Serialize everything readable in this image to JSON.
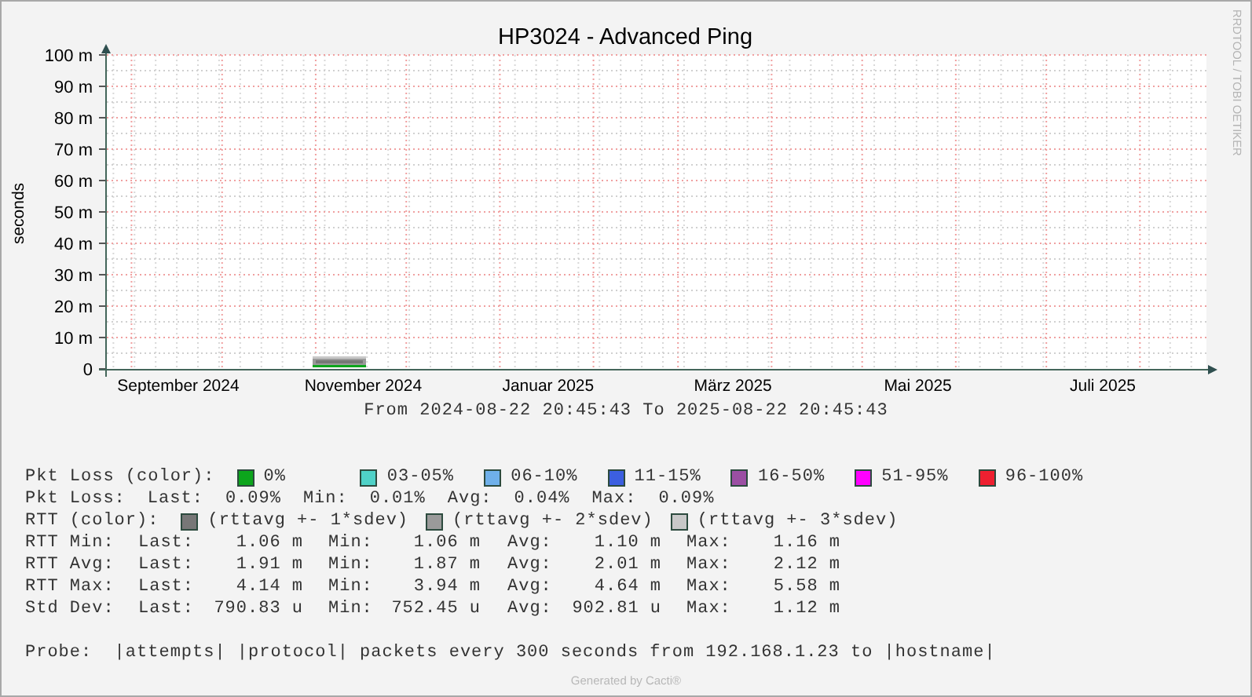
{
  "chart": {
    "title": "HP3024 - Advanced Ping",
    "watermark": "RRDTOOL / TOBI OETIKER",
    "ylabel": "seconds",
    "yticks": [
      "100 m",
      "90 m",
      "80 m",
      "70 m",
      "60 m",
      "50 m",
      "40 m",
      "30 m",
      "20 m",
      "10 m",
      "0"
    ],
    "xticks": [
      "September 2024",
      "November 2024",
      "Januar 2025",
      "März 2025",
      "Mai 2025",
      "Juli 2025"
    ],
    "period": "From 2024-08-22 20:45:43 To 2025-08-22 20:45:43"
  },
  "legend": [
    {
      "kind": "swatches",
      "label": "Pkt Loss (color):",
      "items": [
        {
          "label": "0%",
          "color": "#0ca51c"
        },
        {
          "label": "03-05%",
          "color": "#4fd2c8"
        },
        {
          "label": "06-10%",
          "color": "#6fb0ea"
        },
        {
          "label": "11-15%",
          "color": "#3c5fe0"
        },
        {
          "label": "16-50%",
          "color": "#9b4fa3"
        },
        {
          "label": "51-95%",
          "color": "#ff00ff"
        },
        {
          "label": "96-100%",
          "color": "#ee2030"
        }
      ]
    },
    {
      "kind": "inline",
      "label": "Pkt Loss:",
      "cells": [
        {
          "name": "Last:",
          "value": "0.09%"
        },
        {
          "name": "Min:",
          "value": "0.01%"
        },
        {
          "name": "Avg:",
          "value": "0.04%"
        },
        {
          "name": "Max:",
          "value": "0.09%"
        }
      ]
    },
    {
      "kind": "swatches",
      "label": "RTT (color):",
      "items": [
        {
          "label": "(rttavg +- 1*sdev)",
          "color": "#777777"
        },
        {
          "label": "(rttavg +- 2*sdev)",
          "color": "#9a9a9a"
        },
        {
          "label": "(rttavg +- 3*sdev)",
          "color": "#c8c8c8"
        }
      ]
    },
    {
      "kind": "table",
      "label": "RTT Min:",
      "cells": [
        {
          "name": "Last:",
          "value": "1.06 m"
        },
        {
          "name": "Min:",
          "value": "1.06 m"
        },
        {
          "name": "Avg:",
          "value": "1.10 m"
        },
        {
          "name": "Max:",
          "value": "1.16 m"
        }
      ]
    },
    {
      "kind": "table",
      "label": "RTT Avg:",
      "cells": [
        {
          "name": "Last:",
          "value": "1.91 m"
        },
        {
          "name": "Min:",
          "value": "1.87 m"
        },
        {
          "name": "Avg:",
          "value": "2.01 m"
        },
        {
          "name": "Max:",
          "value": "2.12 m"
        }
      ]
    },
    {
      "kind": "table",
      "label": "RTT Max:",
      "cells": [
        {
          "name": "Last:",
          "value": "4.14 m"
        },
        {
          "name": "Min:",
          "value": "3.94 m"
        },
        {
          "name": "Avg:",
          "value": "4.64 m"
        },
        {
          "name": "Max:",
          "value": "5.58 m"
        }
      ]
    },
    {
      "kind": "table",
      "label": "Std Dev:",
      "cells": [
        {
          "name": "Last:",
          "value": "790.83 u"
        },
        {
          "name": "Min:",
          "value": "752.45 u"
        },
        {
          "name": "Avg:",
          "value": "902.81 u"
        },
        {
          "name": "Max:",
          "value": "1.12 m"
        }
      ]
    }
  ],
  "probe": "Probe:  |attempts| |protocol| packets every 300 seconds from 192.168.1.23 to |hostname|",
  "footer": "Generated by Cacti®"
}
